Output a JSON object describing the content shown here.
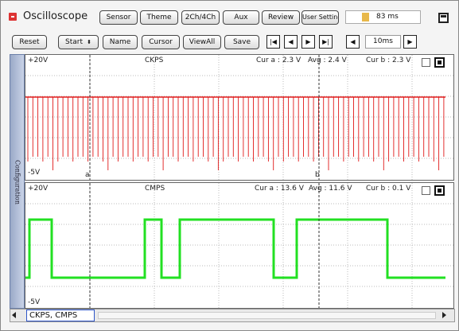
{
  "app": {
    "title": "Oscilloscope",
    "accent": "#d33333"
  },
  "toolbar_top": {
    "buttons": [
      "Sensor",
      "Theme",
      "2Ch/4Ch",
      "Aux",
      "Review",
      "User Setting"
    ],
    "time_readout": "83 ms"
  },
  "toolbar_bottom": {
    "reset": "Reset",
    "start": "Start",
    "name": "Name",
    "cursor": "Cursor",
    "viewall": "ViewAll",
    "save": "Save",
    "nav": {
      "first": "|◀",
      "prev": "◀",
      "next": "▶",
      "last": "▶|"
    },
    "timebase": {
      "prev_icon": "◀",
      "value": "10ms",
      "next_icon": "▶"
    }
  },
  "side_tab": {
    "label": "Configuration"
  },
  "channels": [
    {
      "name": "CKPS",
      "top_label": "+20V",
      "bottom_label": "-5V",
      "cur_a": "Cur a : 2.3 V",
      "avg": "Avg : 2.4 V",
      "cur_b": "Cur b : 2.3 V",
      "color": "#e01818",
      "cursor_a_label": "a",
      "cursor_b_label": "b"
    },
    {
      "name": "CMPS",
      "top_label": "+20V",
      "bottom_label": "-5V",
      "cur_a": "Cur a : 13.6 V",
      "avg": "Avg : 11.6 V",
      "cur_b": "Cur b : 0.1 V",
      "color": "#22e022"
    }
  ],
  "status": {
    "selected_channels": "CKPS, CMPS"
  }
}
